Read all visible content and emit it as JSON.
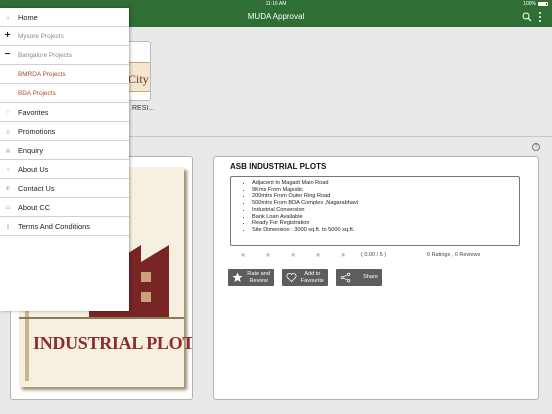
{
  "status_bar": {
    "time": "11:16 AM",
    "battery": "100%"
  },
  "nav": {
    "title": "MUDA Approval",
    "search_icon": "search-icon",
    "more_icon": "more-vertical-icon"
  },
  "project_thumb": {
    "city_text": "City",
    "label": "RESI..."
  },
  "menu": {
    "items": [
      {
        "label": "Home",
        "icon": "home-icon",
        "kind": "item"
      },
      {
        "label": "Mysore Projects",
        "icon": "plus-icon",
        "kind": "head"
      },
      {
        "label": "Bangalore Projects",
        "icon": "minus-icon",
        "kind": "head"
      },
      {
        "label": "BMRDA Projects",
        "icon": "",
        "kind": "sub"
      },
      {
        "label": "BDA Projects",
        "icon": "",
        "kind": "sub"
      },
      {
        "label": "Favorites",
        "icon": "heart-icon",
        "kind": "item"
      },
      {
        "label": "Promotions",
        "icon": "bell-icon",
        "kind": "item"
      },
      {
        "label": "Enquiry",
        "icon": "enquiry-icon",
        "kind": "item"
      },
      {
        "label": "About Us",
        "icon": "info-icon",
        "kind": "item"
      },
      {
        "label": "Contact Us",
        "icon": "phone-icon",
        "kind": "item"
      },
      {
        "label": "About CC",
        "icon": "card-icon",
        "kind": "item"
      },
      {
        "label": "Terms And Conditions",
        "icon": "document-icon",
        "kind": "item"
      }
    ]
  },
  "listing": {
    "image_title": "INDUSTRIAL PLOTS",
    "title": "ASB INDUSTRIAL PLOTS",
    "features": [
      "Adjacent to Magadi Main Road",
      "9Kms From Majestic",
      "200mtrs From Outer Ring Road",
      "500mtrs From BDA Complex ,Nagarabhavi",
      "Industrial Conversion",
      "Bank Loan Available",
      "Ready For Registration",
      "Site Dimension : 3000 sq.ft. to 5000 sq.ft."
    ],
    "rating": {
      "stars_filled": 0,
      "stars_total": 5,
      "score_text": "( 0.00 / 5 )",
      "summary": "0 Ratings , 0 Reviews"
    },
    "buttons": [
      {
        "label_line1": "Rate and",
        "label_line2": "Review",
        "icon": "star-icon"
      },
      {
        "label_line1": "Add to",
        "label_line2": "Favourite",
        "icon": "heart-outline-icon"
      },
      {
        "label_line1": "Share",
        "label_line2": "",
        "icon": "share-icon"
      }
    ]
  },
  "colors": {
    "nav_bg": "#2f6e35",
    "menu_sub_text": "#a0522d",
    "button_bg": "#5d5d5d",
    "poster_title": "#8e2c2c"
  }
}
